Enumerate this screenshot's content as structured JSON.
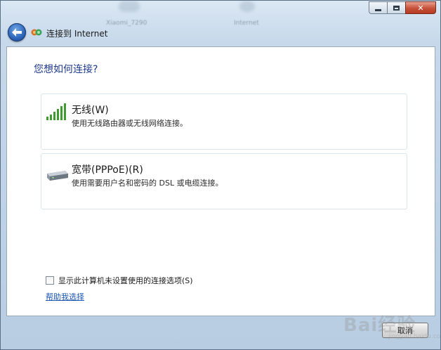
{
  "background_window": {
    "labels": [
      "Xiaomi_7290",
      "Internet"
    ]
  },
  "window": {
    "title": "连接到 Internet",
    "controls": {
      "minimize": "minimize",
      "maximize": "maximize",
      "close": "✕"
    }
  },
  "page": {
    "heading": "您想如何连接?",
    "options": [
      {
        "title": "无线(W)",
        "description": "使用无线路由器或无线网络连接。",
        "icon": "wifi-signal-icon"
      },
      {
        "title": "宽带(PPPoE)(R)",
        "description": "使用需要用户名和密码的 DSL 或电缆连接。",
        "icon": "modem-icon"
      }
    ],
    "checkbox_label": "显示此计算机未设置使用的连接选项(S)",
    "checkbox_checked": false,
    "help_link": "帮助我选择"
  },
  "footer": {
    "cancel_label": "取消"
  },
  "watermark": {
    "text": "Bai经验",
    "sub": "jingyan.baidu.com"
  },
  "colors": {
    "heading": "#1e3a8a",
    "link": "#1a55b3",
    "close": "#c75038"
  }
}
